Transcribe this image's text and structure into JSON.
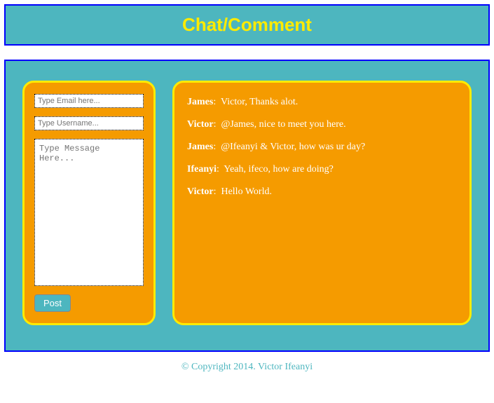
{
  "header": {
    "title": "Chat/Comment"
  },
  "form": {
    "email_placeholder": "Type Email here...",
    "username_placeholder": "Type Username...",
    "message_placeholder": "Type Message Here...",
    "post_label": "Post"
  },
  "messages": [
    {
      "name": "James",
      "text": "Victor, Thanks alot."
    },
    {
      "name": "Victor",
      "text": "@James, nice to meet you here."
    },
    {
      "name": "James",
      "text": "@Ifeanyi & Victor, how was ur day?"
    },
    {
      "name": "Ifeanyi",
      "text": "Yeah, ifeco, how are doing?"
    },
    {
      "name": "Victor",
      "text": "Hello World."
    }
  ],
  "footer": {
    "text": "© Copyright 2014. Victor Ifeanyi"
  }
}
